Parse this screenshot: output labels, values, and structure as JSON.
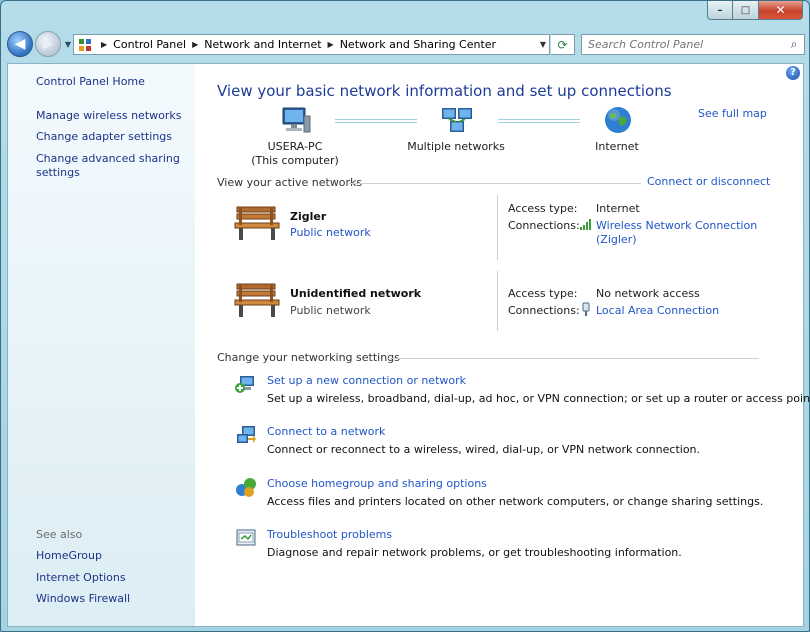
{
  "window": {
    "minimize_glyph": "–",
    "maximize_glyph": "□",
    "close_glyph": "✕"
  },
  "nav": {
    "back_glyph": "◀",
    "forward_glyph": "▶",
    "breadcrumbs": [
      "Control Panel",
      "Network and Internet",
      "Network and Sharing Center"
    ],
    "search_placeholder": "Search Control Panel"
  },
  "sidebar": {
    "home": "Control Panel Home",
    "links": [
      "Manage wireless networks",
      "Change adapter settings",
      "Change advanced sharing",
      "settings"
    ],
    "see_also_header": "See also",
    "see_also": [
      "HomeGroup",
      "Internet Options",
      "Windows Firewall"
    ]
  },
  "main": {
    "help_glyph": "?",
    "title": "View your basic network information and set up connections",
    "see_full_map": "See full map",
    "map": {
      "pc_name": "USERA-PC",
      "pc_sub": "(This computer)",
      "middle": "Multiple networks",
      "internet": "Internet"
    },
    "active_label": "View your active networks",
    "connect_disconnect": "Connect or disconnect",
    "networks": [
      {
        "name": "Zigler",
        "type": "Public network",
        "access_label": "Access type:",
        "access_value": "Internet",
        "conn_label": "Connections:",
        "conn_value_1": "Wireless Network Connection",
        "conn_value_2": "(Zigler)"
      },
      {
        "name": "Unidentified network",
        "type": "Public network",
        "access_label": "Access type:",
        "access_value": "No network access",
        "conn_label": "Connections:",
        "conn_value_1": "Local Area Connection"
      }
    ],
    "change_label": "Change your networking settings",
    "tasks": [
      {
        "title": "Set up a new connection or network",
        "desc": "Set up a wireless, broadband, dial-up, ad hoc, or VPN connection; or set up a router or access point."
      },
      {
        "title": "Connect to a network",
        "desc": "Connect or reconnect to a wireless, wired, dial-up, or VPN network connection."
      },
      {
        "title": "Choose homegroup and sharing options",
        "desc": "Access files and printers located on other network computers, or change sharing settings."
      },
      {
        "title": "Troubleshoot problems",
        "desc": "Diagnose and repair network problems, or get troubleshooting information."
      }
    ]
  }
}
